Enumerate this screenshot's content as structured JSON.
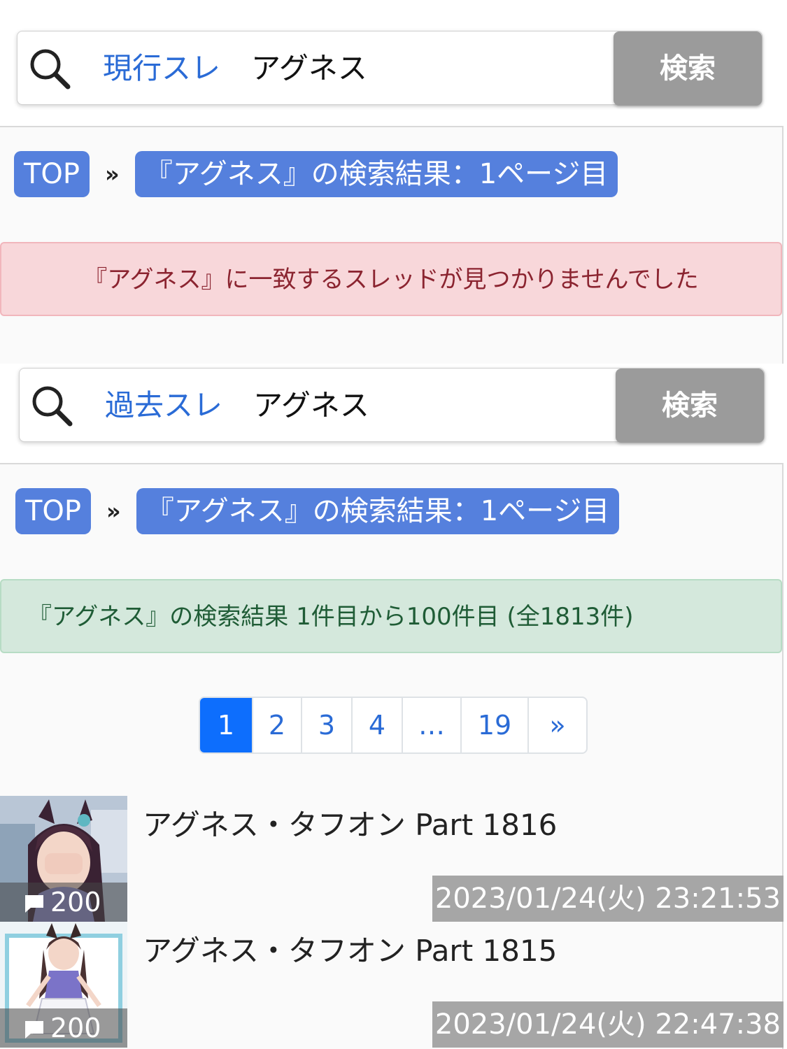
{
  "search_current": {
    "scope": "現行スレ",
    "query": "アグネス",
    "button": "検索"
  },
  "breadcrumb_current": {
    "top": "TOP",
    "sep": "»",
    "current": "『アグネス』の検索結果：1ページ目"
  },
  "alert_none": "『アグネス』に一致するスレッドが見つかりませんでした",
  "search_past": {
    "scope": "過去スレ",
    "query": "アグネス",
    "button": "検索"
  },
  "breadcrumb_past": {
    "top": "TOP",
    "sep": "»",
    "current": "『アグネス』の検索結果：1ページ目"
  },
  "alert_results": "『アグネス』の検索結果 1件目から100件目 (全1813件)",
  "pagination": {
    "pages": [
      "1",
      "2",
      "3",
      "4",
      "…",
      "19",
      "»"
    ],
    "active": "1"
  },
  "threads": [
    {
      "title": "アグネス・タフオン Part 1816",
      "replies": "200",
      "date": "2023/01/24(火) 23:21:53"
    },
    {
      "title": "アグネス・タフオン Part 1815",
      "replies": "200",
      "date": "2023/01/24(火) 22:47:38"
    }
  ],
  "colors": {
    "accent": "#5580dd",
    "link": "#2a6bd6",
    "active_page": "#0d6efd",
    "danger_bg": "#f8d7da",
    "success_bg": "#d4e8dc"
  }
}
